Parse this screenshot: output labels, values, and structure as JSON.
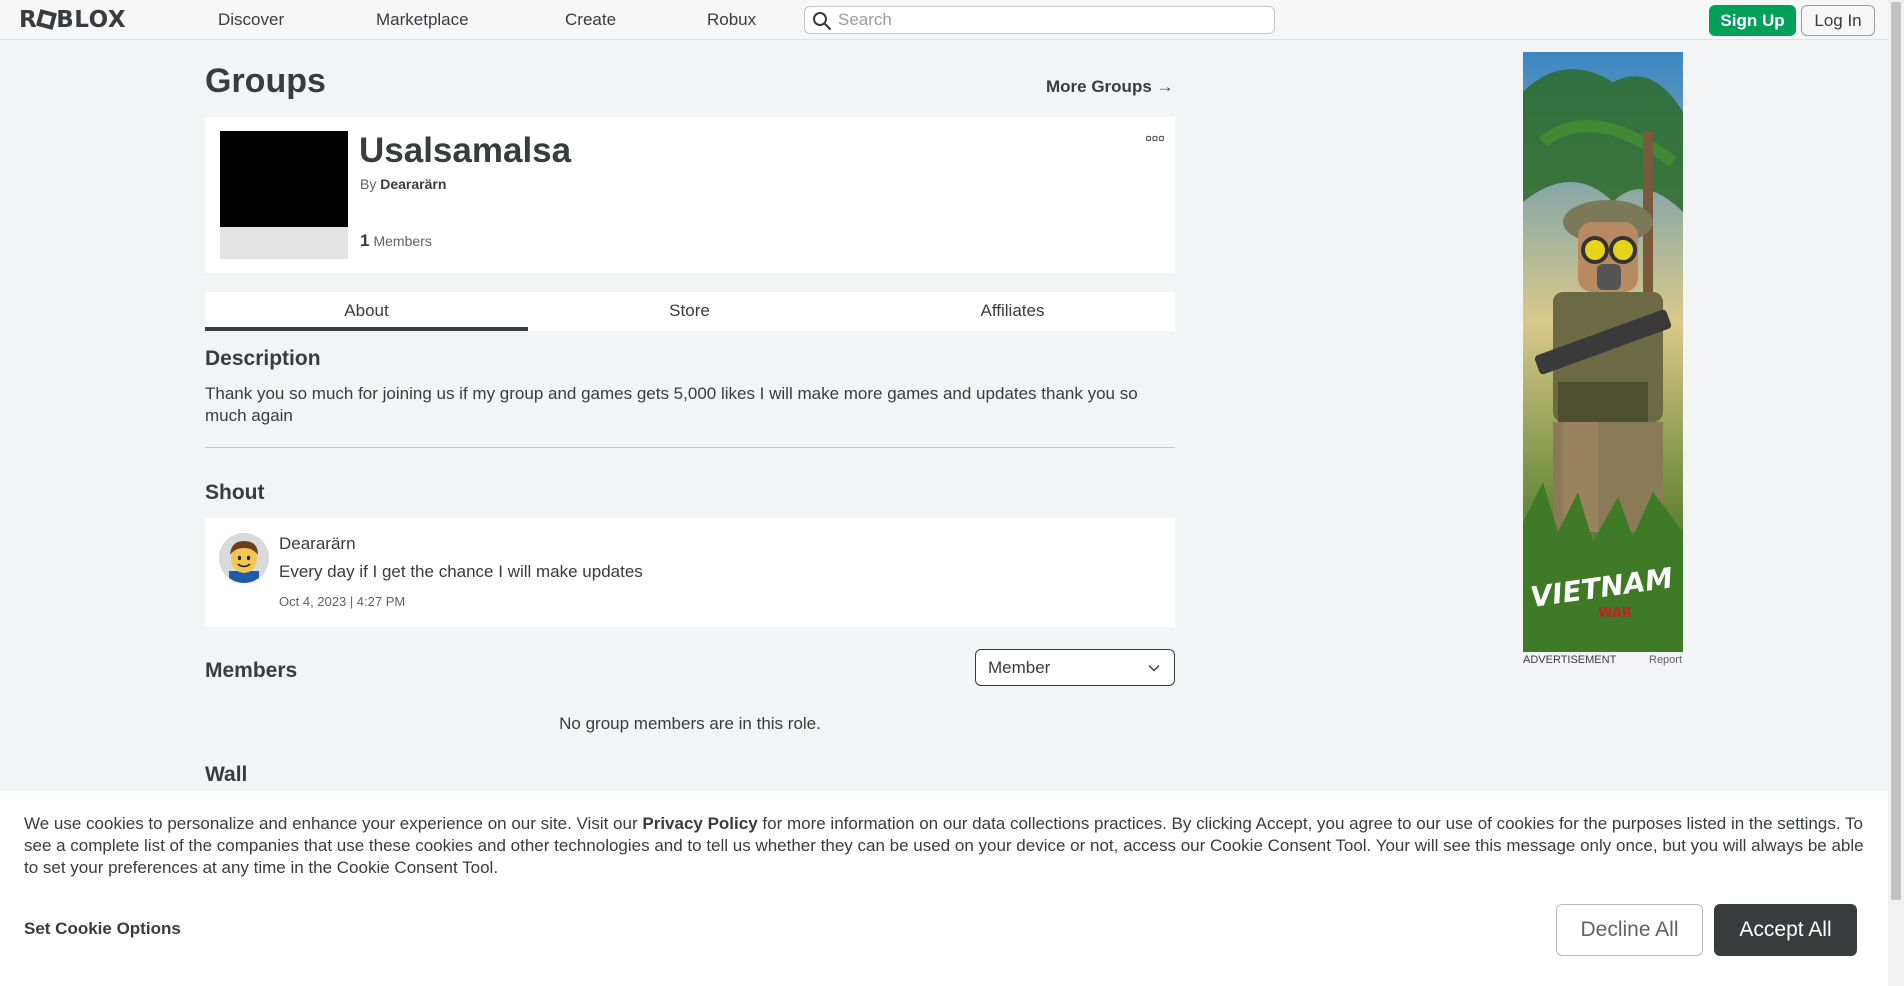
{
  "nav": {
    "logo": "ROBLOX",
    "links": [
      "Discover",
      "Marketplace",
      "Create",
      "Robux"
    ],
    "search_placeholder": "Search",
    "signup_label": "Sign Up",
    "login_label": "Log In"
  },
  "page": {
    "title": "Groups",
    "more_groups": "More Groups →"
  },
  "group": {
    "name": "Usalsamalsa",
    "by_label": "By",
    "owner": "Deararärn",
    "member_count": "1",
    "members_label": "Members"
  },
  "tabs": [
    "About",
    "Store",
    "Affiliates"
  ],
  "description": {
    "heading": "Description",
    "text": "Thank you so much for joining us if my group and games gets 5,000 likes I will make more games and updates thank you so much again"
  },
  "shout": {
    "heading": "Shout",
    "user": "Deararärn",
    "body": "Every day if I get the chance I will make updates",
    "date": "Oct 4, 2023 | 4:27 PM"
  },
  "members": {
    "heading": "Members",
    "role_selected": "Member",
    "empty_message": "No group members are in this role."
  },
  "wall": {
    "heading": "Wall"
  },
  "ad": {
    "label": "ADVERTISEMENT",
    "report": "Report",
    "logo_text": "VIETNAM",
    "logo_sub": "WAR"
  },
  "cookie": {
    "text_before": "We use cookies to personalize and enhance your experience on our site. Visit our ",
    "privacy_link": "Privacy Policy",
    "text_after": " for more information on our data collections practices. By clicking Accept, you agree to our use of cookies for the purposes listed in the settings. To see a complete list of the companies that use these cookies and other technologies and to tell us whether they can be used on your device or not, access our Cookie Consent Tool. Your will see this message only once, but you will always be able to set your preferences at any time in the Cookie Consent Tool.",
    "set_options": "Set Cookie Options",
    "decline": "Decline All",
    "accept": "Accept All"
  },
  "colors": {
    "accent_green": "#00a05a",
    "text_dark": "#393b3d",
    "background": "#f2f4f5"
  }
}
